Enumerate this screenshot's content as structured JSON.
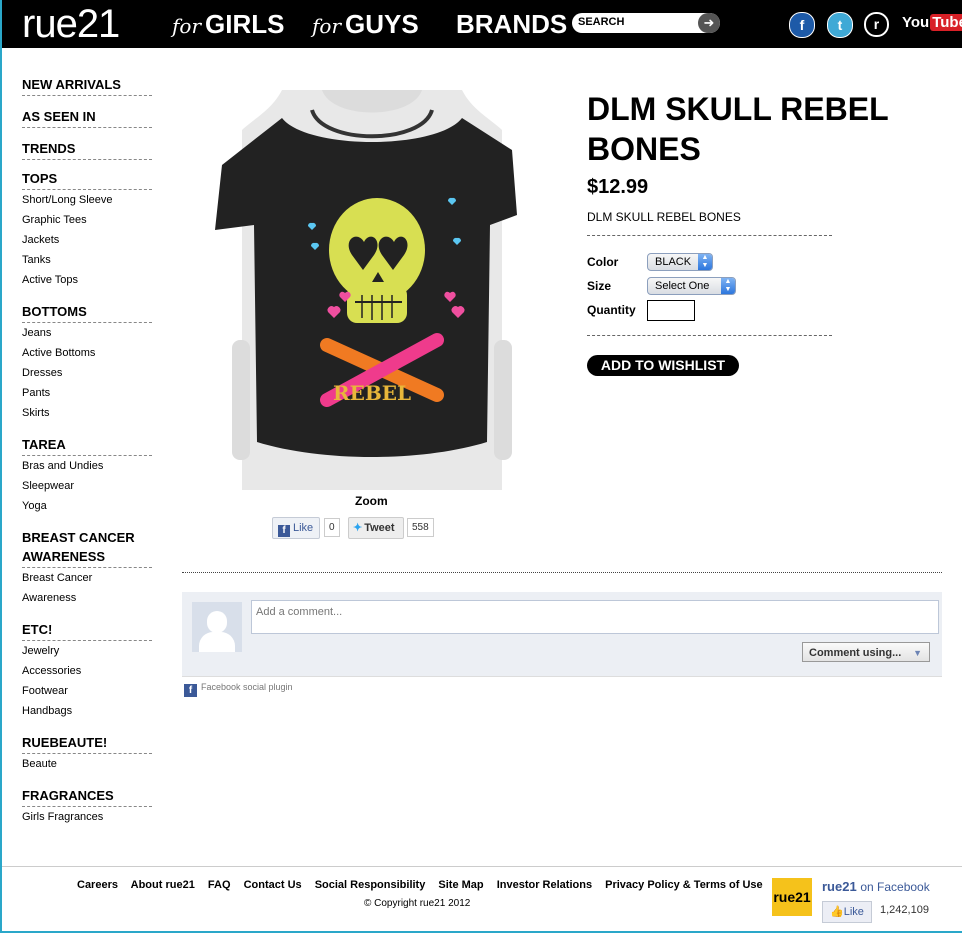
{
  "header": {
    "logo": "rue21",
    "nav": {
      "girls_prefix": "for",
      "girls": "GIRLS",
      "guys_prefix": "for",
      "guys": "GUYS",
      "brands": "BRANDS"
    },
    "search_label": "SEARCH",
    "social_icons": [
      "facebook-icon",
      "twitter-icon",
      "rue21-icon",
      "youtube-icon"
    ],
    "youtube_you": "You",
    "youtube_tube": "Tube"
  },
  "sidebar": {
    "new_arrivals": "NEW ARRIVALS",
    "as_seen_in": "AS SEEN IN",
    "trends": "TRENDS",
    "tops": {
      "label": "TOPS",
      "items": [
        "Short/Long Sleeve",
        "Graphic Tees",
        "Jackets",
        "Tanks",
        "Active Tops"
      ]
    },
    "bottoms": {
      "label": "BOTTOMS",
      "items": [
        "Jeans",
        "Active Bottoms",
        "Dresses",
        "Pants",
        "Skirts"
      ]
    },
    "tarea": {
      "label": "TAREA",
      "items": [
        "Bras and Undies",
        "Sleepwear",
        "Yoga"
      ]
    },
    "breast_cancer": {
      "label": "BREAST CANCER AWARENESS",
      "items": [
        "Breast Cancer",
        "Awareness"
      ]
    },
    "etc": {
      "label": "ETC!",
      "items": [
        "Jewelry",
        "Accessories",
        "Footwear",
        "Handbags"
      ]
    },
    "ruebeaute": {
      "label": "RUEBEAUTE!",
      "items": [
        "Beaute"
      ]
    },
    "fragrances": {
      "label": "FRAGRANCES",
      "items": [
        "Girls Fragrances"
      ]
    }
  },
  "product": {
    "title": "DLM SKULL REBEL BONES",
    "price": "$12.99",
    "description": "DLM SKULL REBEL BONES",
    "shirt_text": "REBEL",
    "zoom": "Zoom",
    "color_label": "Color",
    "color_value": "BLACK",
    "size_label": "Size",
    "size_value": "Select One",
    "quantity_label": "Quantity",
    "quantity_value": "",
    "wishlist": "ADD TO WISHLIST"
  },
  "share": {
    "like": "Like",
    "like_count": "0",
    "tweet": "Tweet",
    "tweet_count": "558"
  },
  "comments": {
    "placeholder": "Add a comment...",
    "comment_using": "Comment using...",
    "plugin": "Facebook social plugin"
  },
  "footer": {
    "links": [
      "Careers",
      "About rue21",
      "FAQ",
      "Contact Us",
      "Social Responsibility",
      "Site Map",
      "Investor Relations",
      "Privacy Policy & Terms of Use"
    ],
    "copyright": "© Copyright rue21 2012",
    "fb_logo": "rue21",
    "fb_name": "rue21",
    "fb_on": "on Facebook",
    "fb_like": "Like",
    "fb_count": "1,242,109"
  },
  "colors": {
    "accent_border": "#2aa7c9",
    "header_bg": "#000000",
    "facebook_blue": "#3b5998",
    "youtube_red": "#d82027",
    "shirt": "#222222",
    "skull": "#d8df52"
  }
}
